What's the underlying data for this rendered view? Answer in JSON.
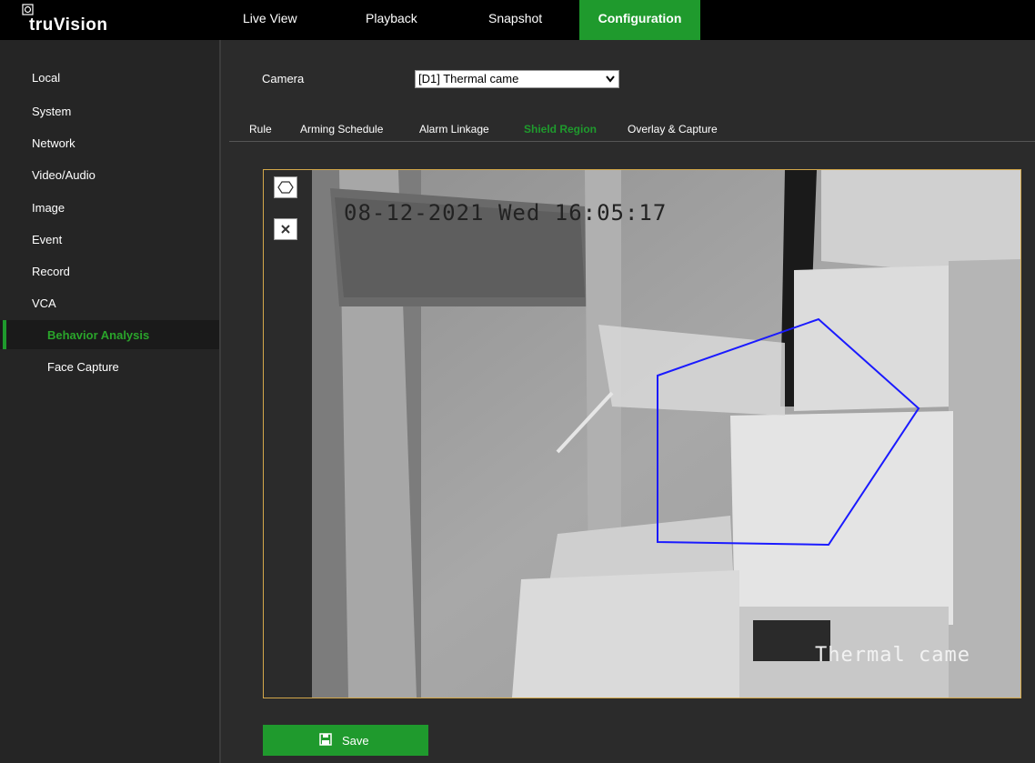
{
  "brand": {
    "logo_text": "truVision"
  },
  "nav": {
    "live_view": "Live View",
    "playback": "Playback",
    "snapshot": "Snapshot",
    "configuration": "Configuration"
  },
  "sidebar": {
    "items": [
      "Local",
      "System",
      "Network",
      "Video/Audio",
      "Image",
      "Event",
      "Record",
      "VCA"
    ],
    "subitems": [
      "Behavior Analysis",
      "Face Capture"
    ],
    "active": "Behavior Analysis"
  },
  "camera": {
    "label": "Camera",
    "selected": "[D1] Thermal came"
  },
  "tabs": {
    "items": [
      "Rule",
      "Arming Schedule",
      "Alarm Linkage",
      "Shield Region",
      "Overlay & Capture"
    ],
    "active": "Shield Region"
  },
  "tools": [
    "polygon-icon",
    "close-icon"
  ],
  "video": {
    "osd_datetime": "08-12-2021 Wed 16:05:17",
    "osd_camera_name": "Thermal came"
  },
  "actions": {
    "save_label": "Save"
  },
  "colors": {
    "accent": "#1f9a2d",
    "shield_polygon": "#1a1aff",
    "frame_border": "#d4a84a"
  }
}
